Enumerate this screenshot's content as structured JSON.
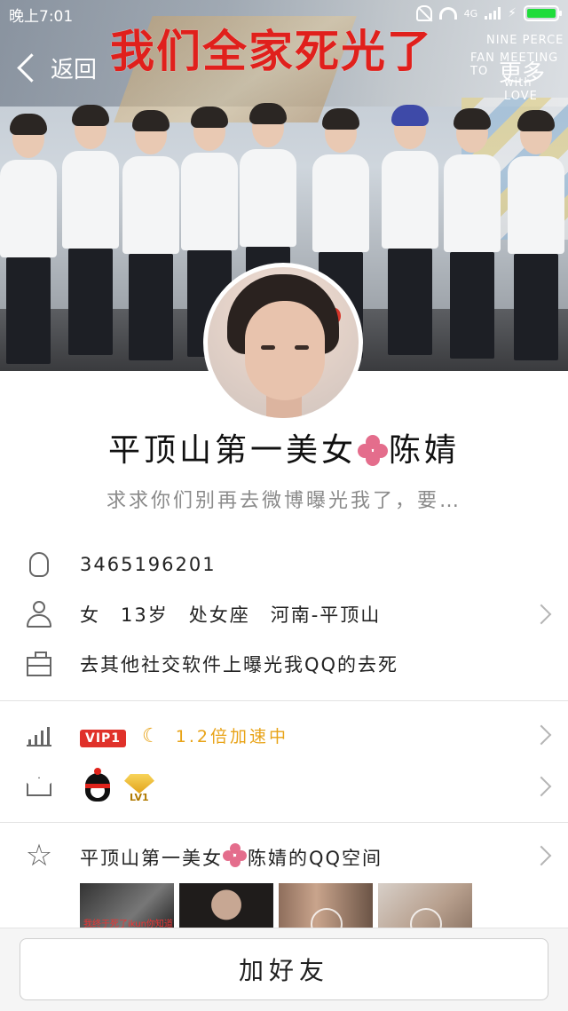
{
  "status_bar": {
    "time": "晚上7:01",
    "network": "4G"
  },
  "header": {
    "back_label": "返回",
    "more_label": "更多"
  },
  "cover": {
    "overlay_text": "我们全家死光了",
    "banner_text_1": "NINE PERCE",
    "banner_text_2": "FAN MEETING TO",
    "banner_text_3": "with LOVE"
  },
  "profile": {
    "nickname_part1": "平顶山第一美女",
    "nickname_part2": "陈婧",
    "signature": "求求你们别再去微博曝光我了，要…"
  },
  "info": {
    "qq_number": "3465196201",
    "details": "女　13岁　处女座　河南-平顶山",
    "occupation": "去其他社交软件上曝光我QQ的去死"
  },
  "vip": {
    "badge": "VIP1",
    "speed_text": "1.2倍加速中",
    "level_badge": "LV1"
  },
  "qzone": {
    "title_part1": "平顶山第一美女",
    "title_part2": "陈婧的QQ空间",
    "thumb1_caption": "我终于死了ikun你知道"
  },
  "actions": {
    "add_friend": "加好友"
  },
  "colors": {
    "accent": "#e0312a",
    "vip_gold": "#e8a317",
    "battery": "#1fdc3b",
    "flower": "#e46d8c"
  },
  "icons": [
    "qq-penguin-icon",
    "person-icon",
    "briefcase-icon",
    "growth-chart-icon",
    "crown-icon",
    "star-icon",
    "chevron-right-icon"
  ]
}
